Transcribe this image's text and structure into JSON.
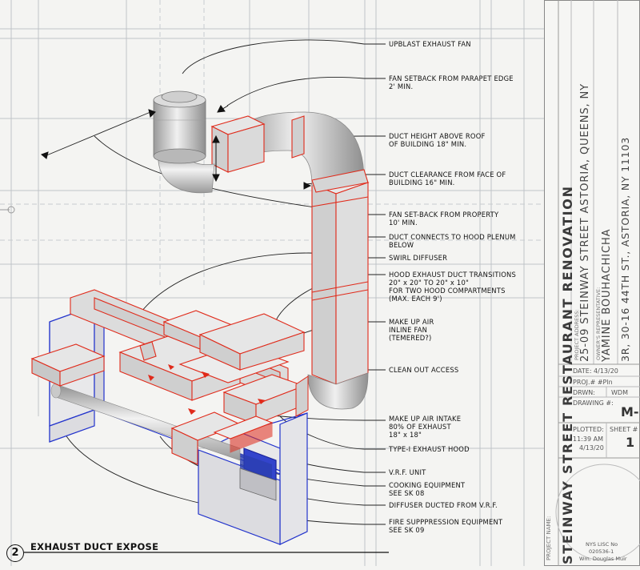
{
  "view": {
    "number": "2",
    "title": "EXHAUST DUCT EXPOSE"
  },
  "callouts": [
    {
      "lines": [
        "UPBLAST EXHAUST FAN"
      ]
    },
    {
      "lines": [
        "FAN SETBACK FROM PARAPET EDGE",
        "2' MIN."
      ]
    },
    {
      "lines": [
        "DUCT HEIGHT ABOVE ROOF",
        "OF BUILDING 18\" MIN."
      ]
    },
    {
      "lines": [
        "DUCT CLEARANCE FROM FACE OF",
        "BUILDING 16\" MIN."
      ]
    },
    {
      "lines": [
        "FAN SET-BACK FROM PROPERTY",
        "10' MIN."
      ]
    },
    {
      "lines": [
        "DUCT CONNECTS TO HOOD PLENUM",
        "BELOW"
      ]
    },
    {
      "lines": [
        "SWIRL DIFFUSER"
      ]
    },
    {
      "lines": [
        "HOOD EXHAUST DUCT TRANSITIONS",
        "20\" x 20\" TO 20\" x 10\"",
        "FOR TWO HOOD COMPARTMENTS",
        "(MAX. EACH 9')"
      ]
    },
    {
      "lines": [
        "MAKE UP AIR",
        "INLINE FAN",
        "(TEMERED?)"
      ]
    },
    {
      "lines": [
        "CLEAN OUT ACCESS"
      ]
    },
    {
      "lines": [
        "MAKE UP AIR INTAKE",
        "80% OF EXHAUST",
        "18\" x 18\""
      ]
    },
    {
      "lines": [
        "TYPE-I EXHAUST HOOD"
      ]
    },
    {
      "lines": [
        "V.R.F. UNIT"
      ]
    },
    {
      "lines": [
        "COOKING EQUIPMENT",
        "SEE SK 08"
      ]
    },
    {
      "lines": [
        "DIFFUSER DUCTED  FROM V.R.F."
      ]
    },
    {
      "lines": [
        "FIRE SUPPPRESSION EQUIPMENT",
        "SEE SK 09"
      ]
    }
  ],
  "title_block": {
    "project_name_label": "PROJECT NAME:",
    "project_name": "STEINWAY STREET RESTAURANT RENOVATION",
    "project_address_label": "PROJECT ADDRESS:",
    "project_address": "25-09 STEINWAY STREET ASTORIA, QUEENS, NY",
    "owner_rep_label": "OWNER'S REPRESENTATIVE:",
    "owner_rep_name": "YAMINE BOUHACHICHA",
    "owner_rep_address": "3R, 30-16 44TH ST., ASTORIA, NY 11103",
    "date": "DATE: 4/13/20",
    "proj_no": "PROJ.#  #Pln",
    "drwn": "DRWN:",
    "drwn_value": "WDM",
    "drawing_no": "DRAWING #:",
    "drawing_value": "M-",
    "plotted_label": "PLOTTED:",
    "plotted_time": "11:39 AM",
    "plotted_date": "4/13/20",
    "sheet_label": "SHEET #",
    "sheet_value": "1",
    "stamp_line1": "NYS LISC No",
    "stamp_line2": "020536-1",
    "stamp_line3": "Wm. Douglas Muir"
  },
  "colors": {
    "hood_blue": "#2233cc",
    "duct_red": "#e02a1a",
    "duct_fill": "#d9d9d9",
    "text_dark": "#333333"
  }
}
